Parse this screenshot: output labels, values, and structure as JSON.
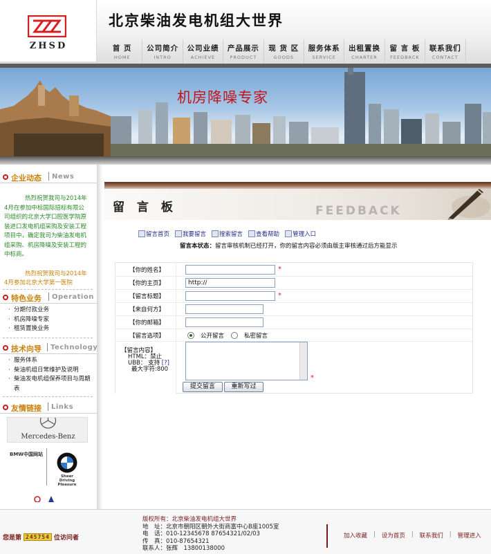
{
  "header": {
    "logo_text": "ZHSD",
    "site_title": "北京柴油发电机组大世界",
    "nav": [
      {
        "cn": "首 页",
        "en": "HOME"
      },
      {
        "cn": "公司简介",
        "en": "INTRO"
      },
      {
        "cn": "公司业绩",
        "en": "ACHIEVE"
      },
      {
        "cn": "产品展示",
        "en": "PRODUCT"
      },
      {
        "cn": "现 货 区",
        "en": "GOODS"
      },
      {
        "cn": "服务体系",
        "en": "SERVICE"
      },
      {
        "cn": "出租置换",
        "en": "CHARTER"
      },
      {
        "cn": "留 言 板",
        "en": "FEEDBACK"
      },
      {
        "cn": "联系我们",
        "en": "CONTACT"
      }
    ]
  },
  "banner": {
    "slogan": "机房降噪专家"
  },
  "sidebar": {
    "news": {
      "cn": "企业动态",
      "en": "News",
      "items": [
        "热烈祝贺我司与2014年4月在参加中标国际招标有限公司组织的北京大学口腔医学院原装进口发电机组采购及安装工程项目中，确定我司为柴油发电机组采购、机房降噪及安装工程的中标商。",
        "热烈祝贺我司与2014年4月参加北京大学第一医院"
      ]
    },
    "business": {
      "cn": "特色业务",
      "en": "Operation",
      "items": [
        "分期付款业务",
        "机房降噪专家",
        "租赁置换业务"
      ]
    },
    "tech": {
      "cn": "技术向导",
      "en": "Technology",
      "items": [
        "服务体系",
        "柴油机组日常维护及说明",
        "柴油发电机组保养项目与周期表"
      ]
    },
    "links": {
      "cn": "友情链接",
      "en": "Links",
      "mercedes": "Mercedes-Benz",
      "bmw_site": "BMW中国网站",
      "bmw_tag1": "Sheer",
      "bmw_tag2": "Driving Pleasure"
    }
  },
  "main": {
    "title": "留 言 板",
    "title_en": "FEEDBACK",
    "links": [
      "留言首页",
      "我要留言",
      "搜索留言",
      "查看帮助",
      "管理入口"
    ],
    "status_label": "留言本状态：",
    "status_text": "留言审核机制已经打开，你的留言内容必须由版主审核通过后方能显示",
    "form": {
      "name_label": "【你的姓名】",
      "homepage_label": "【你的主页】",
      "homepage_value": "http://",
      "title_label": "【留言标题】",
      "from_label": "【来自何方】",
      "email_label": "【你的邮箱】",
      "option_label": "【留言选项】",
      "option_public": "公开留言",
      "option_private": "私密留言",
      "content_label": "【留言内容】",
      "html_info": "HTML：禁止",
      "ubb_info": "UBB： 支持",
      "ubb_help": "[?]",
      "max_chars": "最大字符:800",
      "submit": "提交留言",
      "reset": "重新写过"
    }
  },
  "footer": {
    "visitor_prefix": "您是第",
    "counter": "245754",
    "visitor_suffix": "位访问者",
    "copyright": "版权所有：北京柴油发电机组大世界",
    "address": "地　址：北京市朝阳区朝外大街商富中心B座1005室",
    "phone": "电　话：010-12345678 87654321/02/03",
    "fax": "传　真：010-87654321",
    "contact": "联系人：张辉　13800138000",
    "links": [
      "加入收藏",
      "设为首页",
      "联系我们",
      "管理进入"
    ]
  }
}
